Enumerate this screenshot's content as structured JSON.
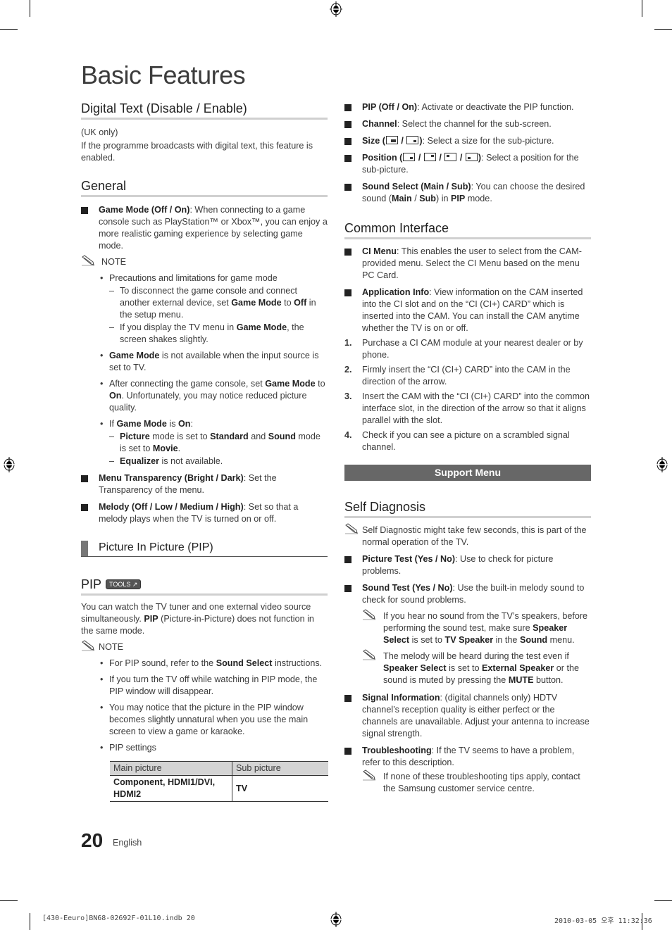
{
  "page": {
    "title": "Basic Features",
    "page_number": "20",
    "language": "English",
    "slug_left": "[430-Eeuro]BN68-02692F-01L10.indb   20",
    "slug_right": "2010-03-05   오후 11:32:36"
  },
  "left": {
    "digital_text": {
      "heading": "Digital Text (Disable / Enable)",
      "line1": "(UK only)",
      "line2": "If the programme broadcasts with digital text, this feature is enabled."
    },
    "general": {
      "heading": "General",
      "game_mode": {
        "term": "Game Mode (Off / On)",
        "desc": ": When connecting to a game console such as PlayStation™ or Xbox™, you can enjoy a more realistic gaming experience by selecting game mode."
      },
      "note_label": "NOTE",
      "b1": "Precautions and limitations for game mode",
      "b1_d1": {
        "t1": "To disconnect the game console and connect another external device, set ",
        "k1": "Game Mode",
        "t2": " to ",
        "k2": "Off",
        "t3": " in the setup menu."
      },
      "b1_d2": {
        "t1": "If you display the TV menu in ",
        "k1": "Game Mode",
        "t2": ", the screen shakes slightly."
      },
      "b2": {
        "k1": "Game Mode",
        "t1": " is not available when the input source is set to TV."
      },
      "b3": {
        "t1": "After connecting the game console, set ",
        "k1": "Game Mode",
        "t2": " to ",
        "k2": "On",
        "t3": ". Unfortunately, you may notice reduced picture quality."
      },
      "b4": {
        "t1": "If ",
        "k1": "Game Mode",
        "t2": " is ",
        "k2": "On",
        "t3": ":"
      },
      "b4_d1": {
        "k1": "Picture",
        "t1": " mode is set to ",
        "k2": "Standard",
        "t2": " and ",
        "k3": "Sound",
        "t3": " mode is set to ",
        "k4": "Movie",
        "t4": "."
      },
      "b4_d2": {
        "k1": "Equalizer",
        "t1": " is not available."
      },
      "menu_transparency": {
        "term": "Menu Transparency (Bright / Dark)",
        "desc": ": Set the Transparency of the menu."
      },
      "melody": {
        "term": "Melody (Off / Low / Medium / High)",
        "desc": ": Set so that a melody plays when the TV is turned on or off."
      }
    },
    "pip_section": {
      "subhead": "Picture In Picture (PIP)",
      "heading": "PIP",
      "tools_badge": "TOOLS",
      "intro": {
        "t1": "You can watch the TV tuner and one external video source simultaneously. ",
        "k1": "PIP",
        "t2": " (Picture-in-Picture) does not function in the same mode."
      },
      "note_label": "NOTE",
      "n1": {
        "t1": "For PIP sound, refer to the ",
        "k1": "Sound Select",
        "t2": " instructions."
      },
      "n2": "If you turn the TV off while watching in PIP mode, the PIP window will disappear.",
      "n3": "You may notice that the picture in the PIP window becomes slightly unnatural when you use the main screen to view a game or karaoke.",
      "n4": "PIP settings",
      "table": {
        "headers": [
          "Main picture",
          "Sub picture"
        ],
        "rows": [
          [
            "Component, HDMI1/DVI, HDMI2",
            "TV"
          ]
        ]
      }
    }
  },
  "right": {
    "pip_items": {
      "pip": {
        "term": "PIP (Off / On)",
        "desc": ": Activate or deactivate the PIP function."
      },
      "channel": {
        "term": "Channel",
        "desc": ": Select the channel for the sub-screen."
      },
      "size": {
        "term": "Size (",
        "sep": " / ",
        "close": ")",
        "desc": ": Select a size for the sub-picture."
      },
      "position": {
        "term": "Position (",
        "sep": " / ",
        "close": ")",
        "desc": ": Select a position for the sub-picture."
      },
      "sound_select": {
        "term": "Sound Select (Main / Sub)",
        "t1": ": You can choose the desired sound (",
        "k1": "Main",
        "t2": " / ",
        "k2": "Sub",
        "t3": ") in ",
        "k3": "PIP",
        "t4": " mode."
      }
    },
    "common_interface": {
      "heading": "Common Interface",
      "ci_menu": {
        "term": "CI Menu",
        "desc": ": This enables the user to select from the CAM-provided menu. Select the CI Menu based on the menu PC Card."
      },
      "app_info": {
        "term": "Application Info",
        "desc": ": View information on the CAM inserted into the CI slot and on the “CI (CI+) CARD” which is inserted into the CAM. You can install the CAM anytime whether the TV is on or off."
      },
      "steps": [
        {
          "n": "1.",
          "text": "Purchase a CI CAM module at your nearest dealer or by phone."
        },
        {
          "n": "2.",
          "text": "Firmly insert the “CI (CI+) CARD” into the CAM in the direction of the arrow."
        },
        {
          "n": "3.",
          "text": "Insert the CAM with the “CI (CI+) CARD” into the common interface slot, in the direction of the arrow so that it aligns parallel with the slot."
        },
        {
          "n": "4.",
          "text": "Check if you can see a picture on a scrambled signal channel."
        }
      ]
    },
    "support_menu": "Support Menu",
    "self_diagnosis": {
      "heading": "Self Diagnosis",
      "note": "Self Diagnostic might take few seconds, this is part of the normal operation of the TV.",
      "picture_test": {
        "term": "Picture Test (Yes / No)",
        "desc": ": Use to check for picture problems."
      },
      "sound_test": {
        "term": "Sound Test (Yes / No)",
        "desc": ": Use the built-in melody sound to check for sound problems."
      },
      "sound_note1": {
        "t1": "If you hear no sound from the TV’s speakers, before performing the sound test, make sure ",
        "k1": "Speaker Select",
        "t2": " is set to ",
        "k2": "TV Speaker",
        "t3": " in the ",
        "k3": "Sound",
        "t4": " menu."
      },
      "sound_note2": {
        "t1": "The melody will be heard during the test even if ",
        "k1": "Speaker Select",
        "t2": " is set to ",
        "k2": "External Speaker",
        "t3": " or the sound is muted by pressing the ",
        "k3": "MUTE",
        "t4": " button."
      },
      "signal_info": {
        "term": "Signal Information",
        "desc": ": (digital channels only) HDTV channel’s reception quality is either perfect or the channels are unavailable. Adjust your antenna to increase signal strength."
      },
      "troubleshooting": {
        "term": "Troubleshooting",
        "desc": ": If the TV seems to have a problem, refer to this description."
      },
      "trouble_note": "If none of these troubleshooting tips apply, contact the Samsung customer service centre."
    }
  }
}
